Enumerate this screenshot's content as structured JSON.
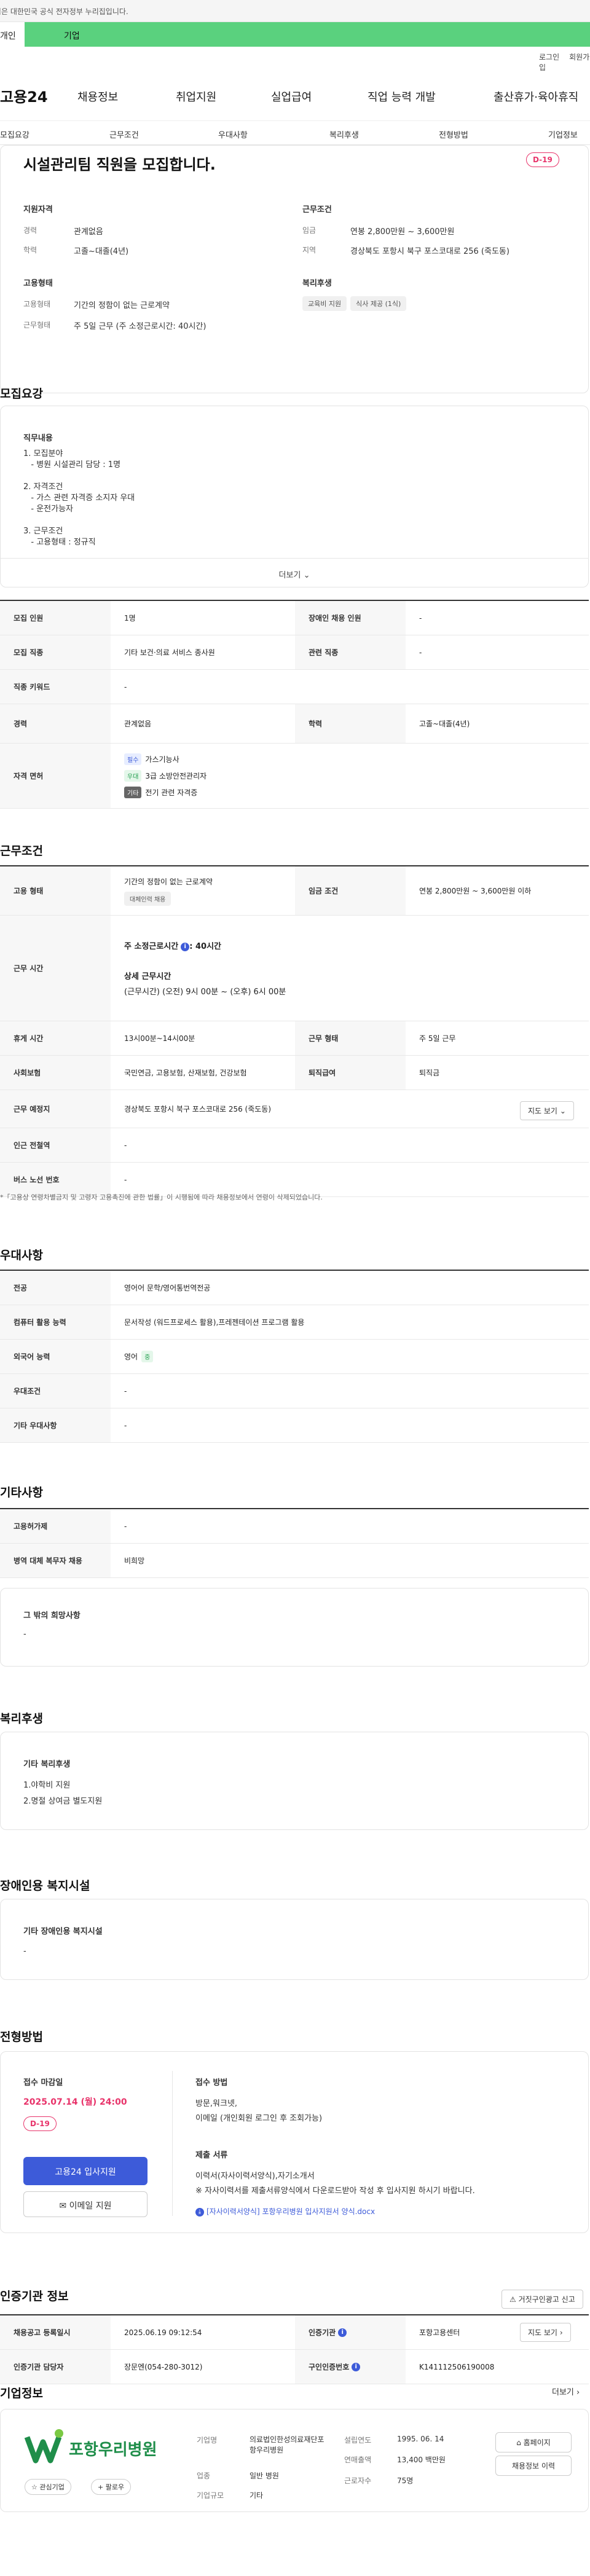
{
  "banner": "이 누리집은 대한민국 공식 전자정부 누리집입니다.",
  "tabs": [
    "개인",
    "기업"
  ],
  "util": [
    "로그인",
    "회원가입"
  ],
  "logo": "고용24",
  "gnb": [
    "채용정보",
    "취업지원",
    "실업급여",
    "직업 능력 개발",
    "출산휴가·육아휴직"
  ],
  "snb": [
    "모집요강",
    "근무조건",
    "우대사항",
    "복리후생",
    "전형방법",
    "기업정보"
  ],
  "summary": {
    "title": "시설관리팀 직원을 모집합니다.",
    "dday": "D-19",
    "qual_title": "지원자격",
    "qual": [
      [
        "경력",
        "관계없음"
      ],
      [
        "학력",
        "고졸~대졸(4년)"
      ]
    ],
    "cond_title": "근무조건",
    "cond": [
      [
        "임금",
        "연봉 2,800만원 ~ 3,600만원"
      ],
      [
        "지역",
        "경상북도 포항시 북구 포스코대로 256 (죽도동)"
      ]
    ],
    "emp_title": "고용형태",
    "emp": [
      [
        "고용형태",
        "기간의 정함이 없는 근로계약"
      ],
      [
        "근무형태",
        "주 5일 근무 (주 소정근로시간: 40시간)"
      ]
    ],
    "welfare_title": "복리후생",
    "welfare": [
      "교육비 지원",
      "식사 제공 (1식)"
    ]
  },
  "recruit": {
    "title": "모집요강",
    "duty_label": "직무내용",
    "duty_lines": [
      "1. 모집분야",
      "   - 병원 시설관리 담당 : 1명",
      "",
      "2. 자격조건",
      "   - 가스 관련 자격증 소지자 우대",
      "   - 운전가능자",
      "",
      "3. 근무조건",
      "   - 고용형태 : 정규직"
    ],
    "more": "더보기",
    "rows": {
      "r1": [
        "모집 인원",
        "1명",
        "장애인 채용 인원",
        "-"
      ],
      "r2": [
        "모집 직종",
        "기타 보건·의료 서비스 종사원",
        "관련 직종",
        "-"
      ],
      "r3": [
        "직종 키워드",
        "-"
      ],
      "r4": [
        "경력",
        "관계없음",
        "학력",
        "고졸~대졸(4년)"
      ],
      "cert_label": "자격 면허",
      "certs": [
        [
          "필수",
          "가스기능사"
        ],
        [
          "우대",
          "3급 소방안전관리자"
        ],
        [
          "기타",
          "전기 관련 자격증"
        ]
      ]
    }
  },
  "work": {
    "title": "근무조건",
    "emp_label": "고용 형태",
    "emp_value": "기간의 정함이 없는 근로계약",
    "emp_chip": "대체인력 채용",
    "wage_label": "임금 조건",
    "wage_value": "연봉 2,800만원 ~ 3,600만원 이하",
    "hours_label": "근무 시간",
    "hours_head": "주 소정근로시간",
    "hours_value": ": 40시간",
    "hours_sub": "상세 근무시간",
    "hours_detail": "(근무시간) (오전) 9시 00분 ~ (오후) 6시 00분",
    "rest_label": "휴게 시간",
    "rest_value": "13시00분~14시00분",
    "form_label": "근무 형태",
    "form_value": "주 5일 근무",
    "ins_label": "사회보험",
    "ins_value": "국민연금, 고용보험, 산재보험, 건강보험",
    "ret_label": "퇴직급여",
    "ret_value": "퇴직금",
    "place_label": "근무 예정지",
    "place_value": "경상북도 포항시 북구 포스코대로 256 (죽도동)",
    "map_btn": "지도 보기",
    "subway_label": "인근 전철역",
    "subway_value": "-",
    "bus_label": "버스 노선 번호",
    "bus_value": "-",
    "note": "*「고용상 연령차별금지 및 고령자 고용촉진에 관한 법률」이 시행됨에 따라 채용정보에서 연령이 삭제되었습니다."
  },
  "pref": {
    "title": "우대사항",
    "rows": [
      [
        "전공",
        "영어어 문학/영어통번역전공"
      ],
      [
        "컴퓨터 활용 능력",
        "문서작성 (워드프로세스 활용),프레젠테이션 프로그램 활용"
      ],
      [
        "외국어 능력",
        "영어"
      ],
      [
        "우대조건",
        "-"
      ],
      [
        "기타 우대사항",
        "-"
      ]
    ],
    "lang_badge": "중"
  },
  "etc": {
    "title": "기타사항",
    "rows": [
      [
        "고용허가제",
        "-"
      ],
      [
        "병역 대체 복무자 채용",
        "비희망"
      ]
    ],
    "other_label": "그 밖의 희망사항",
    "other_value": "-"
  },
  "welfare": {
    "title": "복리후생",
    "label": "기타 복리후생",
    "lines": [
      "1.야학비 지원",
      "2.명절 상여금 별도지원"
    ]
  },
  "disab": {
    "title": "장애인용 복지시설",
    "label": "기타 장애인용 복지시설",
    "value": "-"
  },
  "process": {
    "title": "전형방법",
    "deadline_label": "접수 마감일",
    "deadline": "2025.07.14 (월) 24:00",
    "dday": "D-19",
    "apply_btn": "고용24 입사지원",
    "email_btn": "이메일 지원",
    "method_label": "접수 방법",
    "method_lines": [
      "방문,워크넷,",
      "이메일 (개인회원 로그인 후 조회가능)"
    ],
    "docs_label": "제출 서류",
    "docs_lines": [
      "이력서(자사이력서양식),자기소개서",
      "※ 자사이력서를 제출서류양식에서 다운로드받아 작성 후 입사지원 하시기 바랍니다."
    ],
    "file": "[자사이력서양식] 포항우리병원 입사지원서 양식.docx"
  },
  "cert_org": {
    "title": "인증기관 정보",
    "report_btn": "거짓구인광고 신고",
    "r1": [
      "채용공고 등록일시",
      "2025.06.19 09:12:54",
      "인증기관",
      "포항고용센터"
    ],
    "map_btn": "지도 보기",
    "r2": [
      "인증기관 담당자",
      "장문엔(054-280-3012)",
      "구인인증번호",
      "K141112506190008"
    ]
  },
  "company": {
    "title": "기업정보",
    "more": "더보기",
    "logo_text": "포항우리병원",
    "btn_fav": "관심기업",
    "btn_follow": "팔로우",
    "fields": [
      [
        "기업명",
        "의료법인한성의료재단포항우리병원"
      ],
      [
        "업종",
        "일반 병원"
      ],
      [
        "기업규모",
        "기타"
      ],
      [
        "설립연도",
        "1995. 06. 14"
      ],
      [
        "연매출액",
        "13,400 백만원"
      ],
      [
        "근로자수",
        "75명"
      ]
    ],
    "btn_home": "홈페이지",
    "btn_jobs": "채용정보 이력"
  },
  "colors": {
    "accent": "#3d5bd9",
    "green": "#5ad17e",
    "red": "#e8336a"
  }
}
